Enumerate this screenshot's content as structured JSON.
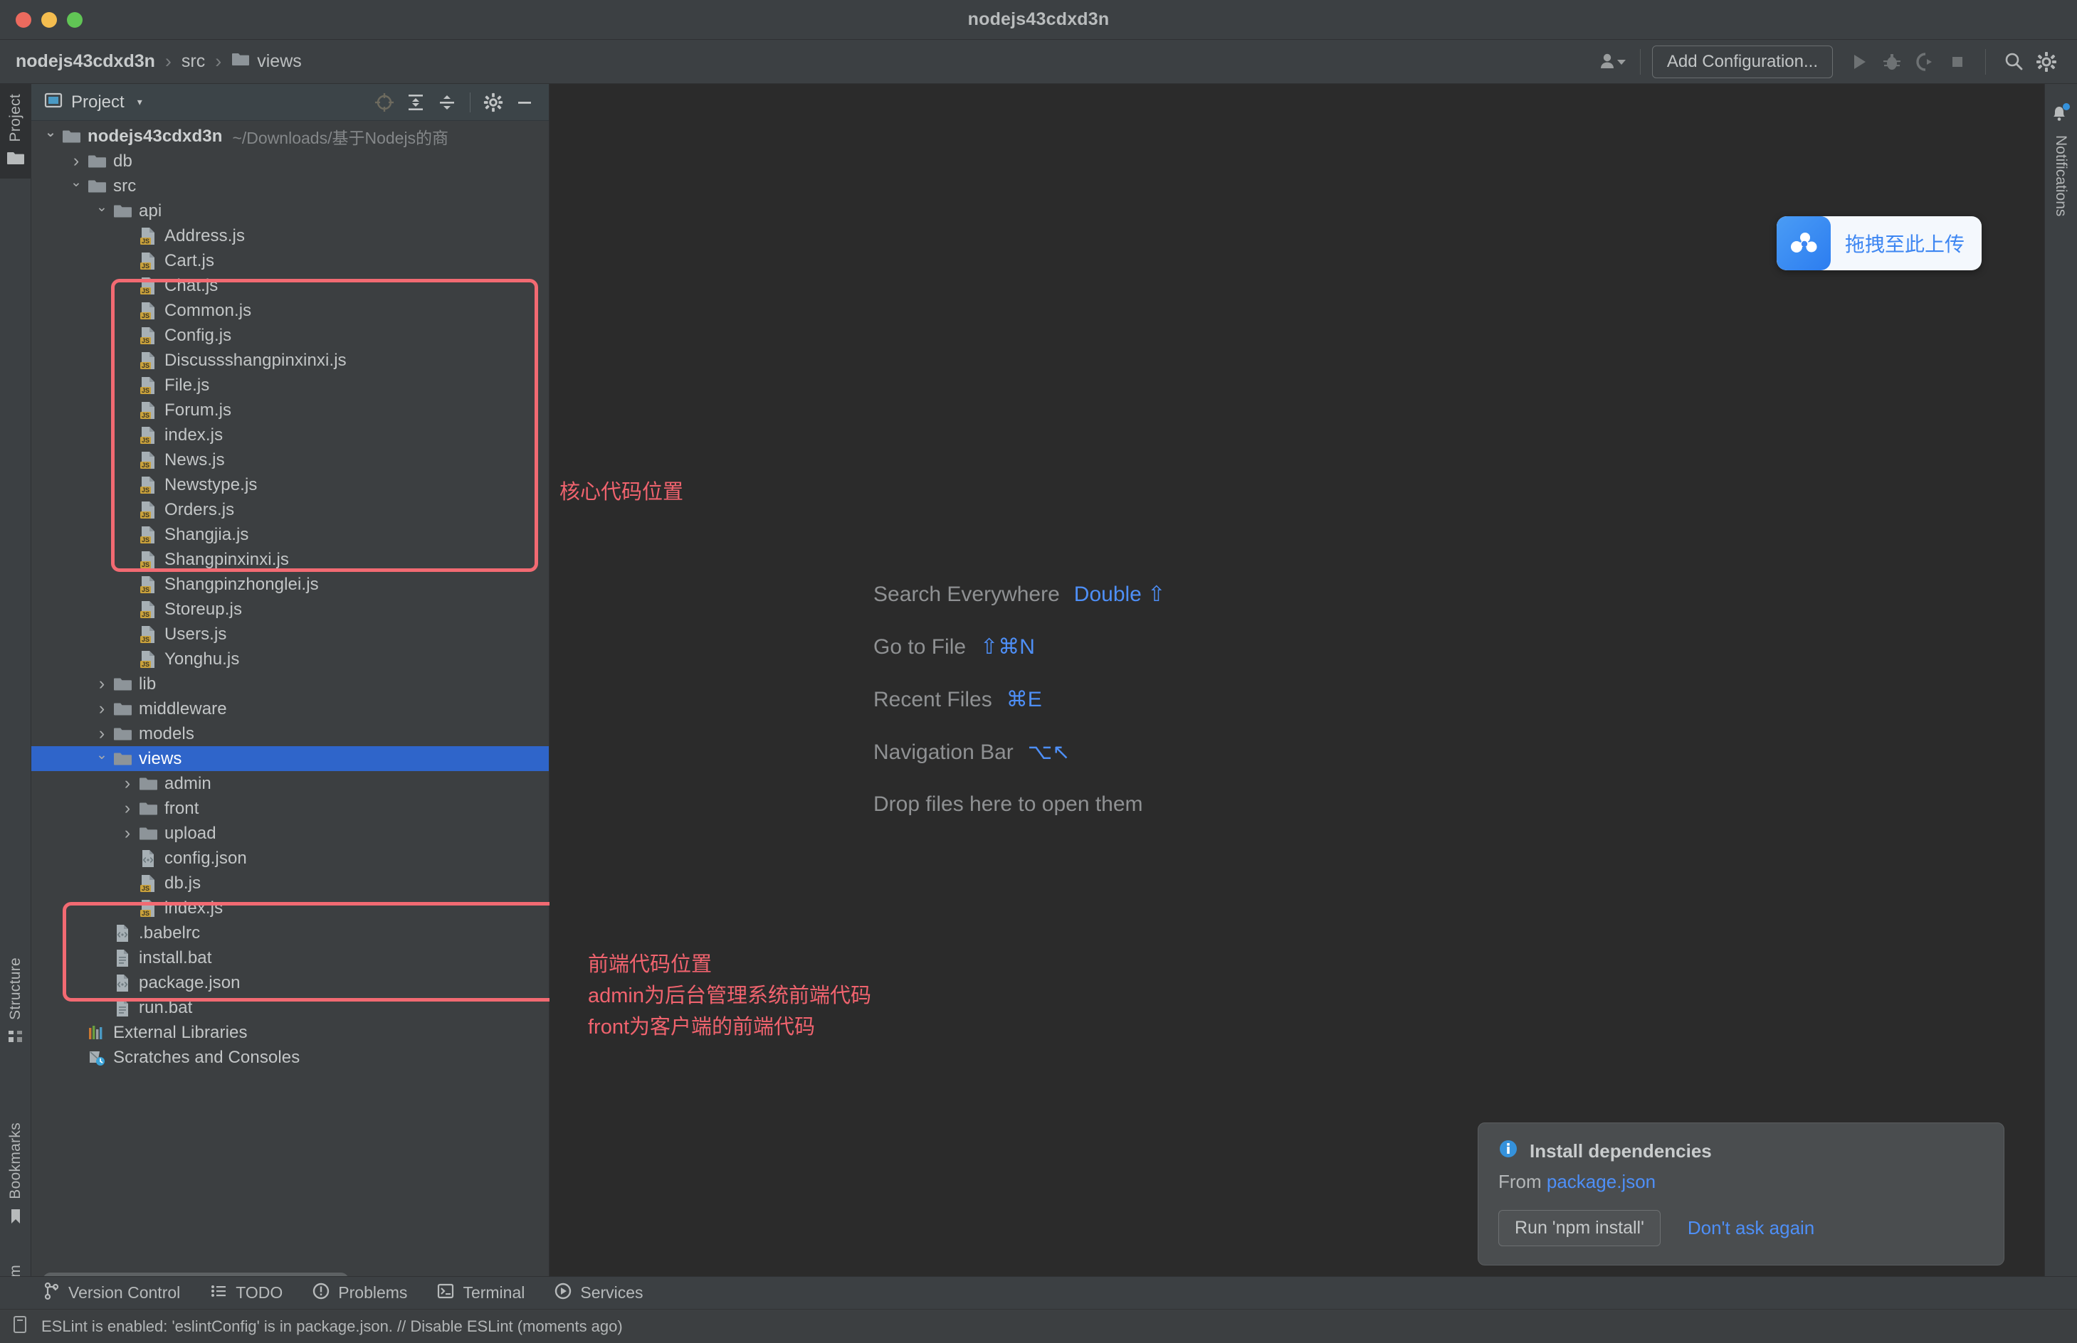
{
  "window": {
    "title": "nodejs43cdxd3n",
    "traffic_lights": [
      "close-red",
      "minimize-yellow",
      "zoom-green"
    ]
  },
  "navbar": {
    "breadcrumb": [
      {
        "label": "nodejs43cdxd3n",
        "icon": null,
        "bold": true
      },
      {
        "label": "src",
        "icon": null,
        "bold": false
      },
      {
        "label": "views",
        "icon": "folder-icon",
        "bold": false
      }
    ],
    "separator": "›",
    "profile_icon": "user-dropdown-icon",
    "add_configuration": "Add Configuration...",
    "run_icon": "run-icon",
    "debug_icon": "debug-icon",
    "coverage_icon": "run-with-coverage-icon",
    "stop_icon": "stop-icon",
    "search_icon": "search-icon",
    "settings_icon": "gear-icon"
  },
  "left_strip": {
    "tabs": [
      {
        "label": "Project",
        "icon": "project-folder-icon",
        "active": true
      },
      {
        "label": "Structure",
        "icon": "structure-icon",
        "active": false
      },
      {
        "label": "Bookmarks",
        "icon": "bookmark-icon",
        "active": false
      },
      {
        "label": "npm",
        "icon": "npm-icon",
        "active": false
      }
    ]
  },
  "right_strip": {
    "tabs": [
      {
        "label": "Notifications",
        "icon": "bell-icon",
        "badge": true
      }
    ]
  },
  "project_panel": {
    "header": {
      "title": "Project",
      "icon": "project-icon",
      "caret": "▾",
      "tools": [
        {
          "name": "select-opened-file-icon",
          "enabled": false
        },
        {
          "name": "expand-all-icon",
          "enabled": true
        },
        {
          "name": "collapse-all-icon",
          "enabled": true
        },
        {
          "name": "gear-icon",
          "enabled": true
        },
        {
          "name": "hide-icon",
          "enabled": true
        }
      ]
    },
    "tree": [
      {
        "label": "nodejs43cdxd3n",
        "sub": "~/Downloads/基于Nodejs的商",
        "icon": "folder-icon",
        "twisty": "expanded",
        "indent": 0,
        "bold": true,
        "selected": false
      },
      {
        "label": "db",
        "icon": "folder-icon",
        "twisty": "collapsed",
        "indent": 1,
        "bold": false,
        "selected": false
      },
      {
        "label": "src",
        "icon": "folder-icon",
        "twisty": "expanded",
        "indent": 1,
        "bold": false,
        "selected": false
      },
      {
        "label": "api",
        "icon": "folder-icon",
        "twisty": "expanded",
        "indent": 2,
        "bold": false,
        "selected": false
      },
      {
        "label": "Address.js",
        "icon": "js-file-icon",
        "twisty": "none",
        "indent": 3,
        "bold": false,
        "selected": false
      },
      {
        "label": "Cart.js",
        "icon": "js-file-icon",
        "twisty": "none",
        "indent": 3,
        "bold": false,
        "selected": false
      },
      {
        "label": "Chat.js",
        "icon": "js-file-icon",
        "twisty": "none",
        "indent": 3,
        "bold": false,
        "selected": false
      },
      {
        "label": "Common.js",
        "icon": "js-file-icon",
        "twisty": "none",
        "indent": 3,
        "bold": false,
        "selected": false
      },
      {
        "label": "Config.js",
        "icon": "js-file-icon",
        "twisty": "none",
        "indent": 3,
        "bold": false,
        "selected": false
      },
      {
        "label": "Discussshangpinxinxi.js",
        "icon": "js-file-icon",
        "twisty": "none",
        "indent": 3,
        "bold": false,
        "selected": false
      },
      {
        "label": "File.js",
        "icon": "js-file-icon",
        "twisty": "none",
        "indent": 3,
        "bold": false,
        "selected": false
      },
      {
        "label": "Forum.js",
        "icon": "js-file-icon",
        "twisty": "none",
        "indent": 3,
        "bold": false,
        "selected": false
      },
      {
        "label": "index.js",
        "icon": "js-file-icon",
        "twisty": "none",
        "indent": 3,
        "bold": false,
        "selected": false
      },
      {
        "label": "News.js",
        "icon": "js-file-icon",
        "twisty": "none",
        "indent": 3,
        "bold": false,
        "selected": false
      },
      {
        "label": "Newstype.js",
        "icon": "js-file-icon",
        "twisty": "none",
        "indent": 3,
        "bold": false,
        "selected": false
      },
      {
        "label": "Orders.js",
        "icon": "js-file-icon",
        "twisty": "none",
        "indent": 3,
        "bold": false,
        "selected": false
      },
      {
        "label": "Shangjia.js",
        "icon": "js-file-icon",
        "twisty": "none",
        "indent": 3,
        "bold": false,
        "selected": false
      },
      {
        "label": "Shangpinxinxi.js",
        "icon": "js-file-icon",
        "twisty": "none",
        "indent": 3,
        "bold": false,
        "selected": false
      },
      {
        "label": "Shangpinzhonglei.js",
        "icon": "js-file-icon",
        "twisty": "none",
        "indent": 3,
        "bold": false,
        "selected": false
      },
      {
        "label": "Storeup.js",
        "icon": "js-file-icon",
        "twisty": "none",
        "indent": 3,
        "bold": false,
        "selected": false
      },
      {
        "label": "Users.js",
        "icon": "js-file-icon",
        "twisty": "none",
        "indent": 3,
        "bold": false,
        "selected": false
      },
      {
        "label": "Yonghu.js",
        "icon": "js-file-icon",
        "twisty": "none",
        "indent": 3,
        "bold": false,
        "selected": false
      },
      {
        "label": "lib",
        "icon": "folder-icon",
        "twisty": "collapsed",
        "indent": 2,
        "bold": false,
        "selected": false
      },
      {
        "label": "middleware",
        "icon": "folder-icon",
        "twisty": "collapsed",
        "indent": 2,
        "bold": false,
        "selected": false
      },
      {
        "label": "models",
        "icon": "folder-icon",
        "twisty": "collapsed",
        "indent": 2,
        "bold": false,
        "selected": false
      },
      {
        "label": "views",
        "icon": "folder-icon",
        "twisty": "expanded",
        "indent": 2,
        "bold": false,
        "selected": true
      },
      {
        "label": "admin",
        "icon": "folder-icon",
        "twisty": "collapsed",
        "indent": 3,
        "bold": false,
        "selected": false
      },
      {
        "label": "front",
        "icon": "folder-icon",
        "twisty": "collapsed",
        "indent": 3,
        "bold": false,
        "selected": false
      },
      {
        "label": "upload",
        "icon": "folder-icon",
        "twisty": "collapsed",
        "indent": 3,
        "bold": false,
        "selected": false
      },
      {
        "label": "config.json",
        "icon": "json-file-icon",
        "twisty": "none",
        "indent": 3,
        "bold": false,
        "selected": false
      },
      {
        "label": "db.js",
        "icon": "js-file-icon",
        "twisty": "none",
        "indent": 3,
        "bold": false,
        "selected": false
      },
      {
        "label": "index.js",
        "icon": "js-file-icon",
        "twisty": "none",
        "indent": 3,
        "bold": false,
        "selected": false
      },
      {
        "label": ".babelrc",
        "icon": "json-file-icon",
        "twisty": "none",
        "indent": 2,
        "bold": false,
        "selected": false
      },
      {
        "label": "install.bat",
        "icon": "bat-file-icon",
        "twisty": "none",
        "indent": 2,
        "bold": false,
        "selected": false
      },
      {
        "label": "package.json",
        "icon": "json-file-icon",
        "twisty": "none",
        "indent": 2,
        "bold": false,
        "selected": false
      },
      {
        "label": "run.bat",
        "icon": "bat-file-icon",
        "twisty": "none",
        "indent": 2,
        "bold": false,
        "selected": false
      },
      {
        "label": "External Libraries",
        "icon": "libraries-icon",
        "twisty": "none",
        "indent": 1,
        "bold": false,
        "selected": false
      },
      {
        "label": "Scratches and Consoles",
        "icon": "scratches-icon",
        "twisty": "none",
        "indent": 1,
        "bold": false,
        "selected": false
      }
    ]
  },
  "editor": {
    "shortcuts": [
      {
        "label": "Search Everywhere",
        "key": "Double ⇧"
      },
      {
        "label": "Go to File",
        "key": "⇧⌘N"
      },
      {
        "label": "Recent Files",
        "key": "⌘E"
      },
      {
        "label": "Navigation Bar",
        "key": "⌥↖"
      }
    ],
    "drop_hint": "Drop files here to open them"
  },
  "annotations": {
    "core_code": "核心代码位置",
    "frontend_code": "前端代码位置\nadmin为后台管理系统前端代码\nfront为客户端的前端代码",
    "color": "#f0636e"
  },
  "upload_widget": {
    "label": "拖拽至此上传",
    "icon": "baidu-netdisk-icon",
    "accent": "#3d86f2"
  },
  "notification_balloon": {
    "title": "Install dependencies",
    "title_icon": "info-icon",
    "from_prefix": "From ",
    "from_link": "package.json",
    "run_button": "Run 'npm install'",
    "dont_ask": "Don't ask again"
  },
  "tool_window_bar": {
    "items": [
      {
        "label": "Version Control",
        "icon": "branch-icon"
      },
      {
        "label": "TODO",
        "icon": "todo-list-icon"
      },
      {
        "label": "Problems",
        "icon": "problems-icon"
      },
      {
        "label": "Terminal",
        "icon": "terminal-icon"
      },
      {
        "label": "Services",
        "icon": "services-icon"
      }
    ]
  },
  "status_bar": {
    "icon": "eslint-status-icon",
    "message": "ESLint is enabled: 'eslintConfig' is in package.json. // Disable ESLint (moments ago)"
  }
}
